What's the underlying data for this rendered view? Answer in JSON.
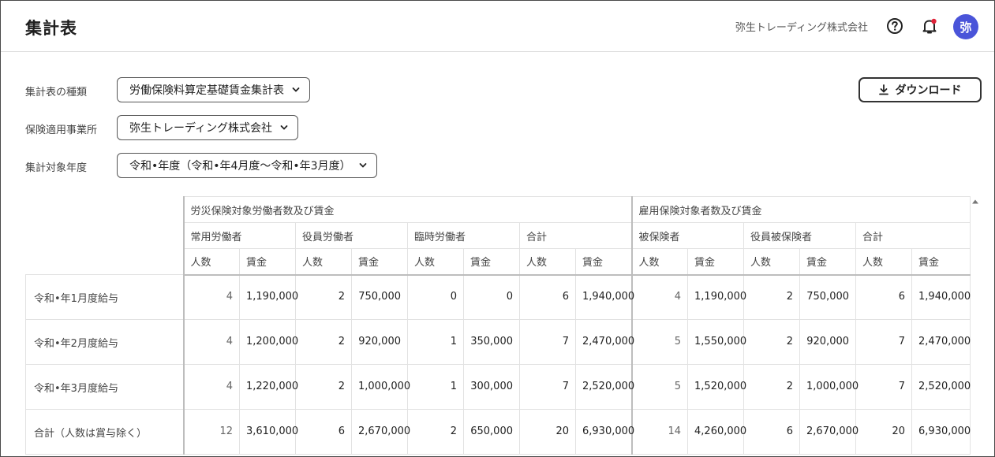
{
  "header": {
    "title": "集計表",
    "company": "弥生トレーディング株式会社",
    "avatar_text": "弥",
    "notification_color": "#e0243a",
    "avatar_color": "#4a54d9"
  },
  "filters": {
    "type": {
      "label": "集計表の種類",
      "value": "労働保険料算定基礎賃金集計表"
    },
    "office": {
      "label": "保険適用事業所",
      "value": "弥生トレーディング株式会社"
    },
    "year": {
      "label": "集計対象年度",
      "value": "令和•年度（令和•年4月度〜令和•年3月度）"
    }
  },
  "download": {
    "label": "ダウンロード"
  },
  "table": {
    "groups": [
      "労災保険対象労働者数及び賃金",
      "雇用保険対象者数及び賃金"
    ],
    "subgroups": [
      "常用労働者",
      "役員労働者",
      "臨時労働者",
      "合計",
      "被保険者",
      "役員被保険者",
      "合計"
    ],
    "cols": [
      "人数",
      "賃金",
      "人数",
      "賃金",
      "人数",
      "賃金",
      "人数",
      "賃金",
      "人数",
      "賃金",
      "人数",
      "賃金",
      "人数",
      "賃金"
    ],
    "rows": [
      {
        "label": "令和•年1月度給与",
        "cells": [
          "4",
          "1,190,000",
          "2",
          "750,000",
          "0",
          "0",
          "6",
          "1,940,000",
          "4",
          "1,190,000",
          "2",
          "750,000",
          "6",
          "1,940,000"
        ]
      },
      {
        "label": "令和•年2月度給与",
        "cells": [
          "4",
          "1,200,000",
          "2",
          "920,000",
          "1",
          "350,000",
          "7",
          "2,470,000",
          "5",
          "1,550,000",
          "2",
          "920,000",
          "7",
          "2,470,000"
        ]
      },
      {
        "label": "令和•年3月度給与",
        "cells": [
          "4",
          "1,220,000",
          "2",
          "1,000,000",
          "1",
          "300,000",
          "7",
          "2,520,000",
          "5",
          "1,520,000",
          "2",
          "1,000,000",
          "7",
          "2,520,000"
        ]
      },
      {
        "label": "合計（人数は賞与除く）",
        "cells": [
          "12",
          "3,610,000",
          "6",
          "2,670,000",
          "2",
          "650,000",
          "20",
          "6,930,000",
          "14",
          "4,260,000",
          "6",
          "2,670,000",
          "20",
          "6,930,000"
        ]
      }
    ]
  }
}
